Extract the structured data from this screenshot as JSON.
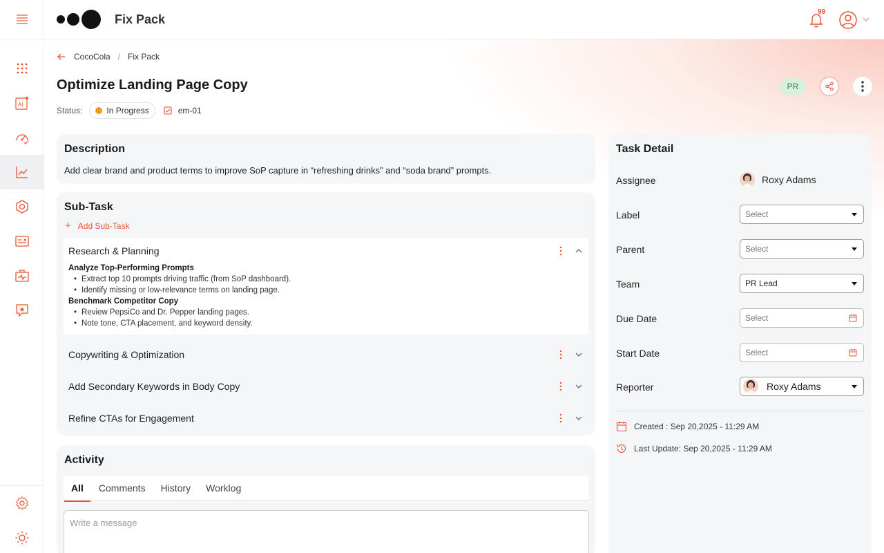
{
  "header": {
    "app_title": "Fix Pack",
    "notification_count": "99"
  },
  "sidebar": {
    "items": [
      {
        "icon": "apps-grid-icon"
      },
      {
        "icon": "ai-icon"
      },
      {
        "icon": "gauge-icon"
      },
      {
        "icon": "analytics-icon",
        "active": true
      },
      {
        "icon": "hex-settings-icon"
      },
      {
        "icon": "dashboard-card-icon"
      },
      {
        "icon": "briefcase-activity-icon"
      },
      {
        "icon": "star-chat-icon"
      },
      {
        "icon": "settings-icon"
      },
      {
        "icon": "theme-sun-icon"
      }
    ]
  },
  "breadcrumb": {
    "parent": "CocoCola",
    "separator": "/",
    "current": "Fix Pack"
  },
  "task": {
    "title": "Optimize Landing Page Copy",
    "status_label": "Status:",
    "status": "In Progress",
    "id": "em-01",
    "owner_badge": "PR"
  },
  "description": {
    "title": "Description",
    "text": "Add clear brand and product terms to improve SoP capture in “refreshing drinks” and “soda brand” prompts."
  },
  "subtasks": {
    "title": "Sub-Task",
    "add_label": "Add Sub-Task",
    "items": [
      {
        "title": "Research & Planning",
        "expanded": true,
        "groups": [
          {
            "heading": "Analyze Top-Performing Prompts",
            "bullets": [
              "Extract top 10 prompts driving traffic (from SoP dashboard).",
              "Identify missing or low-relevance terms on landing page."
            ]
          },
          {
            "heading": "Benchmark Competitor Copy",
            "bullets": [
              "Review PepsiCo and Dr. Pepper landing pages.",
              "Note tone, CTA placement, and keyword density."
            ]
          }
        ]
      },
      {
        "title": "Copywriting & Optimization",
        "expanded": false
      },
      {
        "title": "Add Secondary Keywords in Body Copy",
        "expanded": false
      },
      {
        "title": "Refine CTAs for Engagement",
        "expanded": false
      }
    ]
  },
  "activity": {
    "title": "Activity",
    "tabs": [
      "All",
      "Comments",
      "History",
      "Worklog"
    ],
    "active_tab": "All",
    "message_placeholder": "Write a message"
  },
  "task_detail": {
    "title": "Task Detail",
    "assignee_label": "Assignee",
    "assignee": "Roxy Adams",
    "label_label": "Label",
    "label_value": "Select",
    "parent_label": "Parent",
    "parent_value": "Select",
    "team_label": "Team",
    "team_value": "PR Lead",
    "due_date_label": "Due Date",
    "due_date_value": "Select",
    "start_date_label": "Start Date",
    "start_date_value": "Select",
    "reporter_label": "Reporter",
    "reporter_value": "Roxy Adams",
    "created": "Created : Sep 20,2025 - 11:29 AM",
    "last_update": "Last Update: Sep 20,2025 - 11:29 AM"
  },
  "colors": {
    "accent": "#e8532f",
    "status_in_progress": "#f59b1b",
    "pr_badge_bg": "#d9f0df"
  }
}
